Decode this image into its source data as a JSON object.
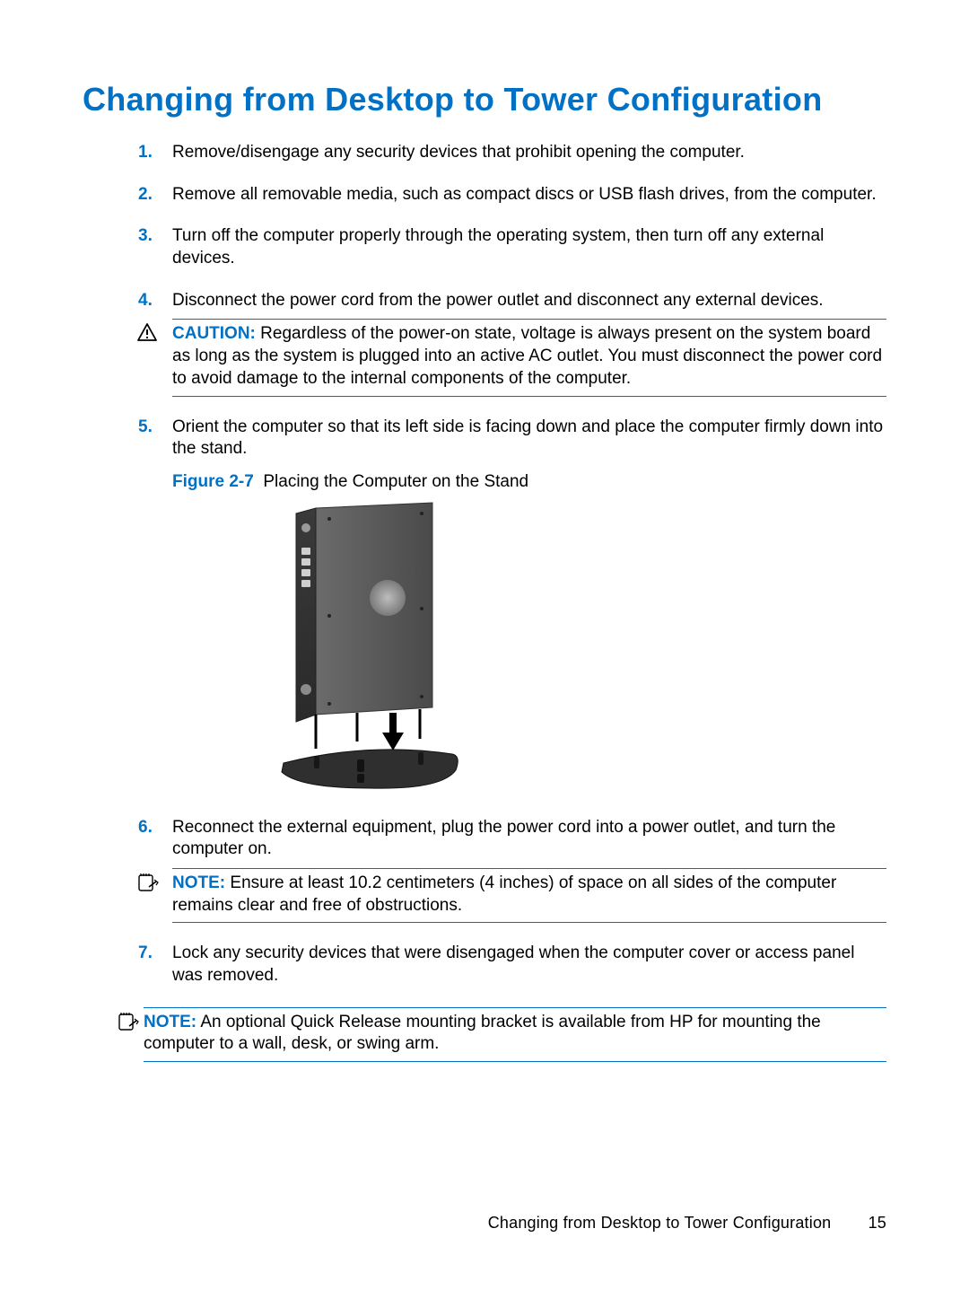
{
  "title": "Changing from Desktop to Tower Configuration",
  "steps": {
    "s1": {
      "num": "1.",
      "text": "Remove/disengage any security devices that prohibit opening the computer."
    },
    "s2": {
      "num": "2.",
      "text": "Remove all removable media, such as compact discs or USB flash drives, from the computer."
    },
    "s3": {
      "num": "3.",
      "text": "Turn off the computer properly through the operating system, then turn off any external devices."
    },
    "s4": {
      "num": "4.",
      "text": "Disconnect the power cord from the power outlet and disconnect any external devices."
    },
    "s5": {
      "num": "5.",
      "text": "Orient the computer so that its left side is facing down and place the computer firmly down into the stand."
    },
    "s6": {
      "num": "6.",
      "text": "Reconnect the external equipment, plug the power cord into a power outlet, and turn the computer on."
    },
    "s7": {
      "num": "7.",
      "text": "Lock any security devices that were disengaged when the computer cover or access panel was removed."
    }
  },
  "caution": {
    "label": "CAUTION:",
    "text": "Regardless of the power-on state, voltage is always present on the system board as long as the system is plugged into an active AC outlet. You must disconnect the power cord to avoid damage to the internal components of the computer."
  },
  "figure": {
    "label": "Figure 2-7",
    "caption": "Placing the Computer on the Stand"
  },
  "note1": {
    "label": "NOTE:",
    "text": "Ensure at least 10.2 centimeters (4 inches) of space on all sides of the computer remains clear and free of obstructions."
  },
  "note2": {
    "label": "NOTE:",
    "text": "An optional Quick Release mounting bracket is available from HP for mounting the computer to a wall, desk, or swing arm."
  },
  "footer": {
    "section": "Changing from Desktop to Tower Configuration",
    "page": "15"
  }
}
